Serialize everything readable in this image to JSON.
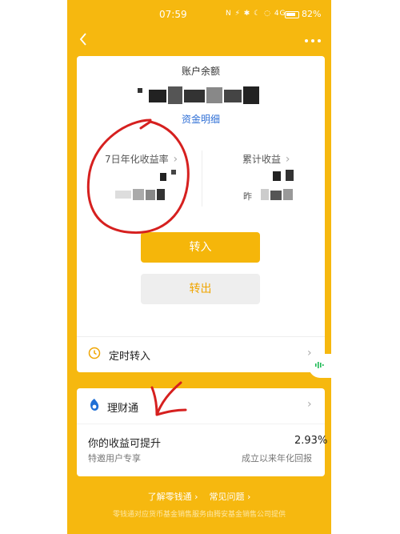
{
  "status": {
    "time": "07:59",
    "icons": "N  ⚡  ✱ ☾ ◌ 4G  ",
    "battery": "82%",
    "battery_level": 0.82
  },
  "nav": {
    "back_icon": "chevron-left-icon",
    "more_icon": "more-icon"
  },
  "account": {
    "balance_title": "账户余额",
    "detail_link": "资金明细"
  },
  "stats": {
    "seven_day_label": "7日年化收益率",
    "cumulative_label": "累计收益",
    "yesterday_prefix": "昨"
  },
  "buttons": {
    "transfer_in": "转入",
    "transfer_out": "转出"
  },
  "timed": {
    "label": "定时转入"
  },
  "licai": {
    "label": "理财通",
    "promo_title": "你的收益可提升",
    "promo_sub": "特邀用户专享",
    "rate": "2.93%",
    "rate_label": "成立以来年化回报"
  },
  "footer": {
    "link1": "了解零钱通",
    "link2": "常见问题",
    "note": "零钱通对应货币基金销售服务由腾安基金销售公司提供"
  },
  "colors": {
    "accent": "#f6b80f",
    "link": "#2f6fd6",
    "annotation": "#d6201f"
  }
}
